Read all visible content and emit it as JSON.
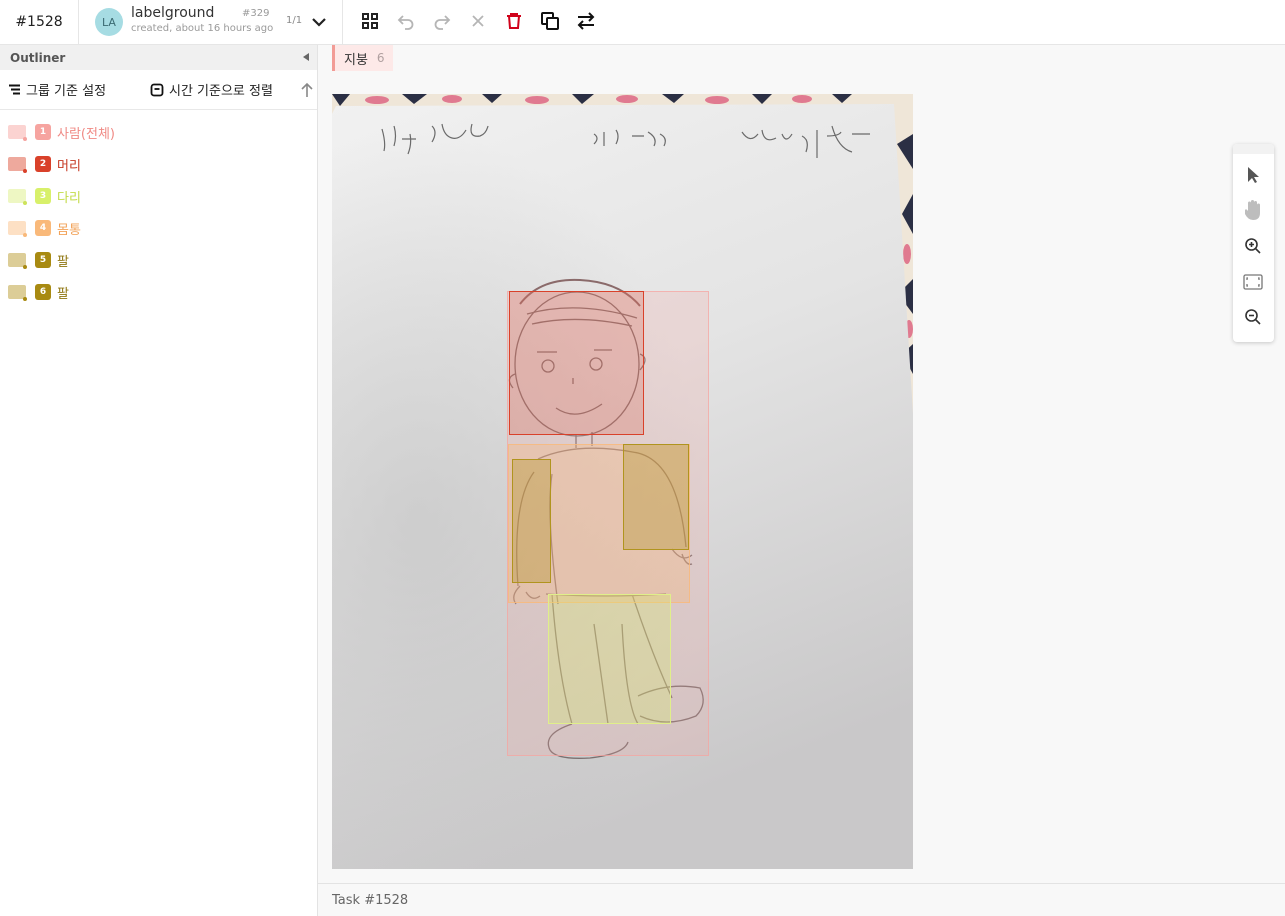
{
  "task": {
    "id_label": "#1528"
  },
  "user": {
    "avatar_initials": "LA",
    "name": "labelground",
    "meta": "created, about 16 hours ago",
    "number": "#329",
    "pager": "1/1"
  },
  "toolbar": {
    "icons": [
      "grid-icon",
      "undo-icon",
      "redo-icon",
      "close-icon",
      "trash-icon",
      "copy-icon",
      "swap-icon"
    ],
    "delete_color": "#d0021b"
  },
  "sidebar": {
    "title": "Outliner",
    "group_label": "그룹 기준 설정",
    "sort_label": "시간 기준으로 정렬",
    "items": [
      {
        "num": "1",
        "label": "사람(전체)",
        "color": "#f6a4a0"
      },
      {
        "num": "2",
        "label": "머리",
        "color": "#d9412a"
      },
      {
        "num": "3",
        "label": "다리",
        "color": "#d8f06a"
      },
      {
        "num": "4",
        "label": "몸통",
        "color": "#f9b97a"
      },
      {
        "num": "5",
        "label": "팔",
        "color": "#a88a12"
      },
      {
        "num": "6",
        "label": "팔",
        "color": "#a88a12"
      }
    ]
  },
  "canvas": {
    "chip_label": "지붕",
    "chip_count": "6",
    "photo_texts": [
      "이름 이현승",
      "나이 10살",
      "성별 남자"
    ]
  },
  "footer": {
    "text": "Task #1528"
  }
}
